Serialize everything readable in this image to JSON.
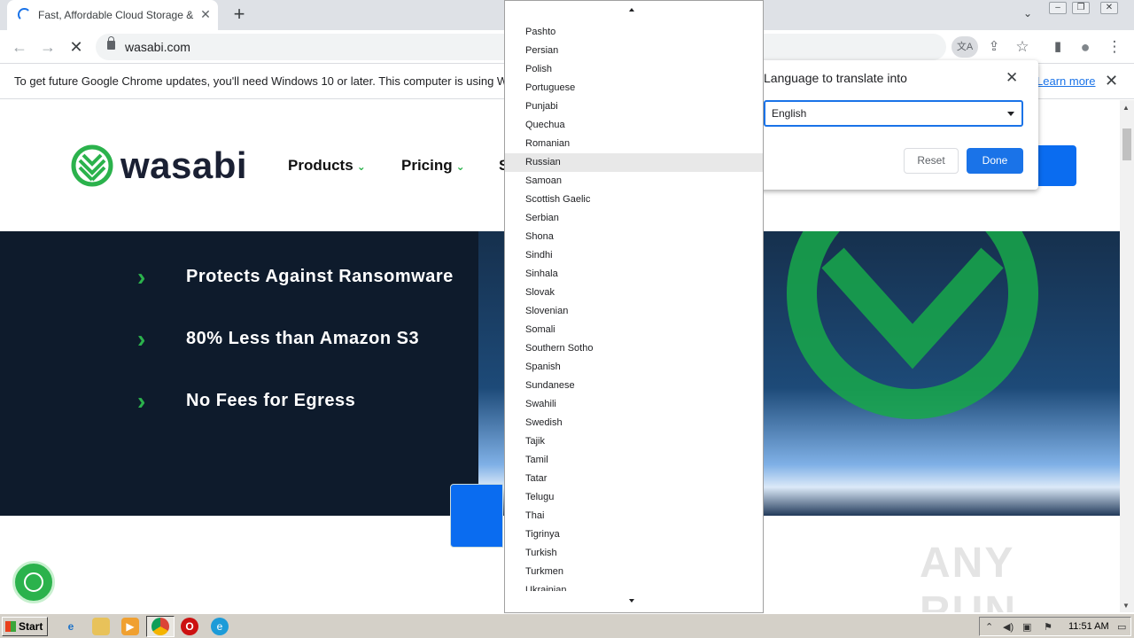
{
  "tab": {
    "title": "Fast, Affordable Cloud Storage & Se",
    "close": "✕"
  },
  "tabstrip": {
    "new_tab": "+",
    "tab_search": "⌄"
  },
  "window_controls": {
    "minimize": "–",
    "restore": "❐",
    "close": "✕"
  },
  "toolbar": {
    "back": "←",
    "forward": "→",
    "stop": "✕",
    "url": "wasabi.com",
    "translate_icon": "文A",
    "share_icon": "⇪",
    "star_icon": "☆",
    "sidepanel_icon": "▮",
    "profile_icon": "●",
    "menu_icon": "⋮"
  },
  "infobar": {
    "message": "To get future Google Chrome updates, you'll need Windows 10 or later. This computer is using Wind",
    "learn_more": "Learn more",
    "close": "✕"
  },
  "site": {
    "logo_text": "wasabi",
    "nav": {
      "products": "Products",
      "pricing": "Pricing",
      "s": "S"
    },
    "chevron": "⌄",
    "hero_bullets": [
      "Protects Against Ransomware",
      "80% Less than Amazon S3",
      "No Fees for Egress"
    ],
    "bullet_arrow": "›"
  },
  "watermark": "ANY RUN",
  "translate_bubble": {
    "title": "Language to translate into",
    "close": "✕",
    "selected": "English",
    "reset": "Reset",
    "done": "Done"
  },
  "language_list": {
    "highlighted": "Russian",
    "items": [
      "Pashto",
      "Persian",
      "Polish",
      "Portuguese",
      "Punjabi",
      "Quechua",
      "Romanian",
      "Russian",
      "Samoan",
      "Scottish Gaelic",
      "Serbian",
      "Shona",
      "Sindhi",
      "Sinhala",
      "Slovak",
      "Slovenian",
      "Somali",
      "Southern Sotho",
      "Spanish",
      "Sundanese",
      "Swahili",
      "Swedish",
      "Tajik",
      "Tamil",
      "Tatar",
      "Telugu",
      "Thai",
      "Tigrinya",
      "Turkish",
      "Turkmen",
      "Ukrainian"
    ]
  },
  "taskbar": {
    "start": "Start",
    "clock": "11:51 AM"
  },
  "colors": {
    "accent_blue": "#1a73e8",
    "wasabi_green": "#2bb24c",
    "hero_bg": "#0e1b2c",
    "cta_blue": "#0a6cf0"
  },
  "icons": {
    "tab_loading": "spinner-icon",
    "secure": "lock-icon",
    "cookie": "cookie-icon"
  }
}
